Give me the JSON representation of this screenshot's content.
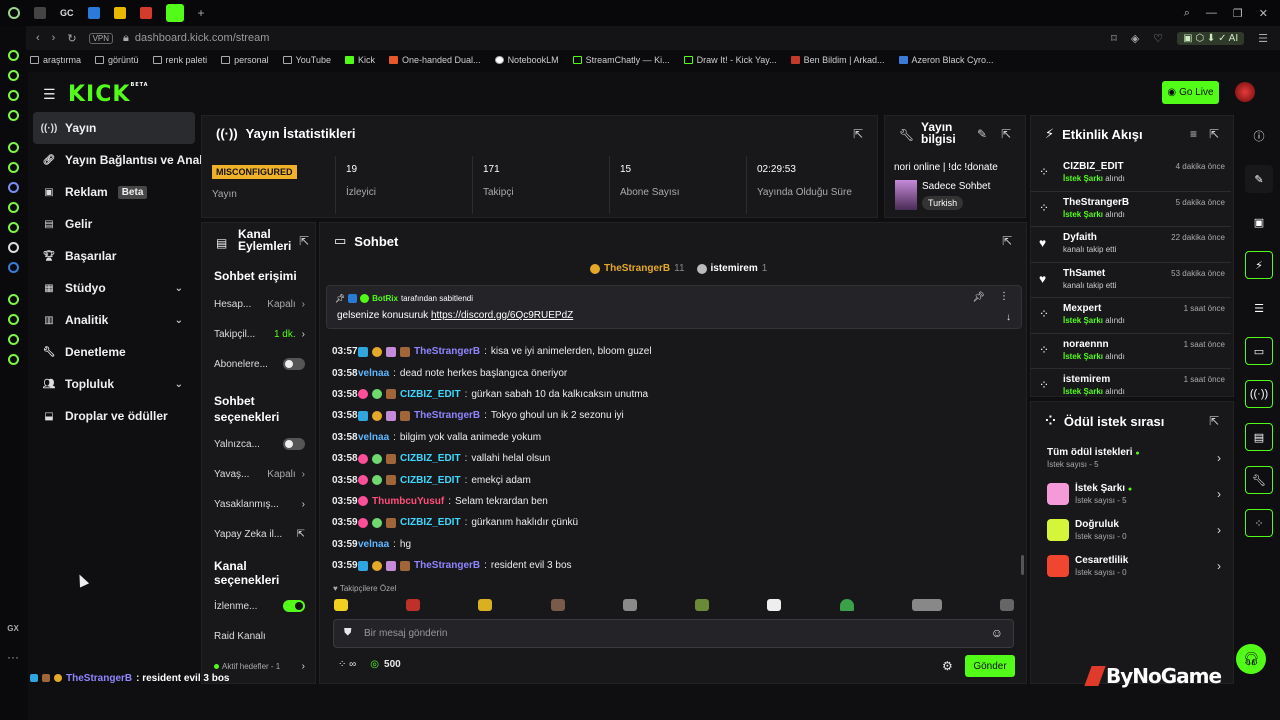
{
  "browser": {
    "tabs": [
      "GC"
    ],
    "url": "dashboard.kick.com/stream",
    "vpn": "VPN",
    "bookmarks": [
      "araştırma",
      "görüntü",
      "renk paleti",
      "personal",
      "YouTube",
      "Kick",
      "One-handed Dual...",
      "NotebookLM",
      "StreamChatly — Ki...",
      "Draw It! - Kick Yay...",
      "Ben Bildim | Arkad...",
      "Azeron Black Cyro..."
    ],
    "ai_label": "AI"
  },
  "header": {
    "logo": "KICK",
    "logo_sup": "BETA",
    "go_live": "Go Live"
  },
  "sidebar": {
    "items": [
      {
        "label": "Yayın"
      },
      {
        "label": "Yayın Bağlantısı ve Anahtar"
      },
      {
        "label": "Reklam",
        "badge": "Beta"
      },
      {
        "label": "Gelir"
      },
      {
        "label": "Başarılar"
      },
      {
        "label": "Stüdyo"
      },
      {
        "label": "Analitik"
      },
      {
        "label": "Denetleme"
      },
      {
        "label": "Topluluk"
      },
      {
        "label": "Droplar ve ödüller"
      }
    ]
  },
  "stats": {
    "title": "Yayın İstatistikleri",
    "status_badge": "MISCONFIGURED",
    "status_label": "Yayın",
    "cells": [
      {
        "value": "19",
        "label": "İzleyici"
      },
      {
        "value": "171",
        "label": "Takipçi"
      },
      {
        "value": "15",
        "label": "Abone Sayısı"
      },
      {
        "value": "02:29:53",
        "label": "Yayında Olduğu Süre"
      }
    ]
  },
  "stream_info": {
    "title": "Yayın bilgisi",
    "stream_title": "nori online | !dc !donate",
    "category": "Sadece Sohbet",
    "tag": "Turkish"
  },
  "channel_actions": {
    "title": "Kanal Eylemleri",
    "chat_access_title": "Sohbet erişimi",
    "chat_access_rows": [
      {
        "label": "Hesap...",
        "value": "Kapalı"
      },
      {
        "label": "Takipçil...",
        "value": "1 dk."
      },
      {
        "label": "Abonelere...",
        "value": ""
      }
    ],
    "chat_options_title": "Sohbet seçenekleri",
    "chat_option_rows": [
      {
        "label": "Yalnızca...",
        "value": ""
      },
      {
        "label": "Yavaş...",
        "value": "Kapalı"
      },
      {
        "label": "Yasaklanmış...",
        "value": ""
      },
      {
        "label": "Yapay Zeka il...",
        "value": ""
      }
    ],
    "channel_options_title": "Kanal seçenekleri",
    "channel_option_rows": [
      {
        "label": "İzlenme...",
        "value": ""
      },
      {
        "label": "Raid Kanalı",
        "value": ""
      },
      {
        "label": "Aktif hedefler - 1",
        "value": ""
      }
    ]
  },
  "chat": {
    "title": "Sohbet",
    "top_users": [
      {
        "name": "TheStrangerB",
        "count": "11"
      },
      {
        "name": "istemirem",
        "count": "1"
      }
    ],
    "pinned": {
      "by_user": "BotRix",
      "by_suffix": "tarafından sabitlendi",
      "text": "gelsenize konusuruk",
      "link": "https://discord.gg/6Qc9RUEPdZ"
    },
    "messages": [
      {
        "time": "03:57",
        "user": "TheStrangerB",
        "color": "#8f86ff",
        "text": "kisa ve iyi animelerden, bloom guzel"
      },
      {
        "time": "03:58",
        "user": "velnaa",
        "color": "#5fb6ff",
        "text": "dead note herkes başlangıca öneriyor"
      },
      {
        "time": "03:58",
        "user": "CIZBIZ_EDIT",
        "color": "#3fd8ff",
        "text": "gürkan sabah 10 da kalkıcaksın unutma"
      },
      {
        "time": "03:58",
        "user": "TheStrangerB",
        "color": "#8f86ff",
        "text": "Tokyo ghoul un ik 2 sezonu iyi"
      },
      {
        "time": "03:58",
        "user": "velnaa",
        "color": "#5fb6ff",
        "text": "bilgim yok valla animede yokum"
      },
      {
        "time": "03:58",
        "user": "CIZBIZ_EDIT",
        "color": "#3fd8ff",
        "text": "vallahi helal olsun"
      },
      {
        "time": "03:58",
        "user": "CIZBIZ_EDIT",
        "color": "#3fd8ff",
        "text": "emekçi adam"
      },
      {
        "time": "03:59",
        "user": "ThumbcuYusuf",
        "color": "#ff4f7b",
        "text": "Selam tekrardan ben"
      },
      {
        "time": "03:59",
        "user": "CIZBIZ_EDIT",
        "color": "#3fd8ff",
        "text": "gürkanım haklıdır çünkü"
      },
      {
        "time": "03:59",
        "user": "velnaa",
        "color": "#5fb6ff",
        "text": "hg"
      },
      {
        "time": "03:59",
        "user": "TheStrangerB",
        "color": "#8f86ff",
        "text": "resident evil 3 bos"
      }
    ],
    "followers_only": "Takipçilere Özel",
    "input_placeholder": "Bir mesaj gönderin",
    "points": "500",
    "send": "Gönder"
  },
  "activity": {
    "title": "Etkinlik Akışı",
    "events": [
      {
        "name": "CIZBIZ_EDIT",
        "highlight": "İstek Şarkı",
        "rest": "alındı",
        "time": "4 dakika önce",
        "icon": "gift"
      },
      {
        "name": "TheStrangerB",
        "highlight": "İstek Şarkı",
        "rest": "alındı",
        "time": "5 dakika önce",
        "icon": "gift"
      },
      {
        "name": "Dyfaith",
        "highlight": "",
        "rest": "kanalı takip etti",
        "time": "22 dakika önce",
        "icon": "heart"
      },
      {
        "name": "ThSamet",
        "highlight": "",
        "rest": "kanalı takip etti",
        "time": "53 dakika önce",
        "icon": "heart"
      },
      {
        "name": "Mexpert",
        "highlight": "İstek Şarkı",
        "rest": "alındı",
        "time": "1 saat önce",
        "icon": "gift"
      },
      {
        "name": "noraennn",
        "highlight": "İstek Şarkı",
        "rest": "alındı",
        "time": "1 saat önce",
        "icon": "gift"
      },
      {
        "name": "istemirem",
        "highlight": "İstek Şarkı",
        "rest": "alındı",
        "time": "1 saat önce",
        "icon": "gift"
      }
    ]
  },
  "rewards": {
    "title": "Ödül istek sırası",
    "items": [
      {
        "name": "Tüm ödül istekleri",
        "sub": "İstek sayısı - 5",
        "color": ""
      },
      {
        "name": "İstek Şarkı",
        "sub": "İstek sayısı - 5",
        "color": "#f59ad8"
      },
      {
        "name": "Doğruluk",
        "sub": "İstek sayısı - 0",
        "color": "#d5f53b"
      },
      {
        "name": "Cesaretlilik",
        "sub": "İstek sayısı - 0",
        "color": "#f0452e"
      }
    ]
  },
  "ticker": {
    "user": "TheStrangerB",
    "text": ": resident evil 3 bos"
  },
  "watermark": "ByNoGame",
  "os": {
    "gx": "GX"
  }
}
